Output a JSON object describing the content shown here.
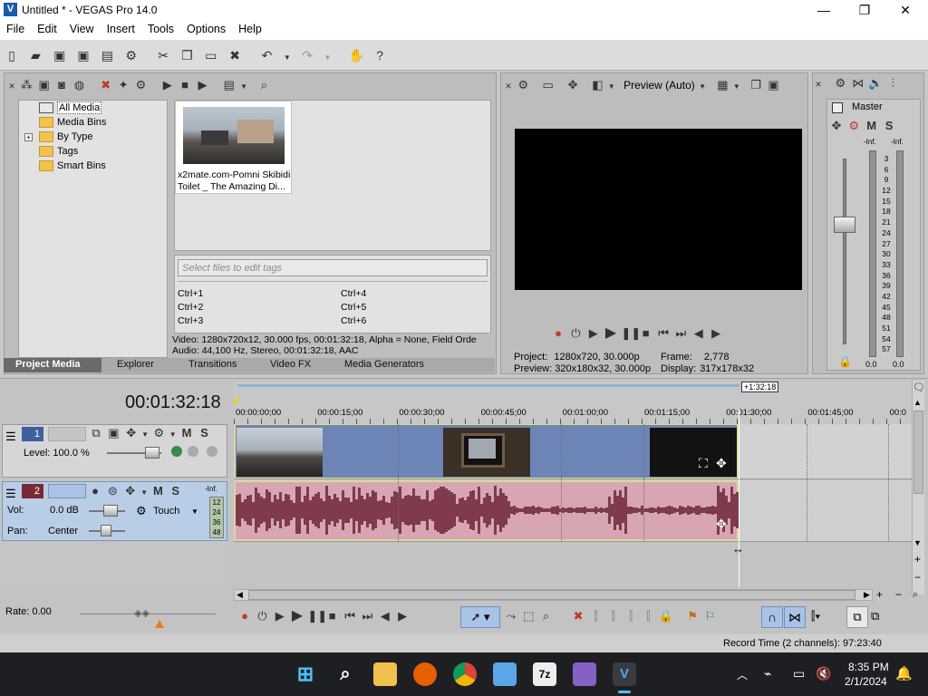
{
  "window": {
    "title": "Untitled * - VEGAS Pro 14.0",
    "minimize": "—",
    "maximize": "❐",
    "close": "✕"
  },
  "menu": [
    "File",
    "Edit",
    "View",
    "Insert",
    "Tools",
    "Options",
    "Help"
  ],
  "project_media": {
    "tree": [
      "All Media",
      "Media Bins",
      "By Type",
      "Tags",
      "Smart Bins"
    ],
    "thumb_caption_1": "x2mate.com-Pomni Skibidi",
    "thumb_caption_2": "Toilet _ The Amazing Di...",
    "tags_placeholder": "Select files to edit tags",
    "shortcuts": [
      "Ctrl+1",
      "Ctrl+2",
      "Ctrl+3",
      "Ctrl+4",
      "Ctrl+5",
      "Ctrl+6"
    ],
    "info_video": "Video: 1280x720x12, 30.000 fps, 00:01:32:18, Alpha = None, Field Orde",
    "info_audio": "Audio: 44,100 Hz, Stereo, 00:01:32:18, AAC"
  },
  "tabs": [
    "Project Media",
    "Explorer",
    "Transitions",
    "Video FX",
    "Media Generators"
  ],
  "preview": {
    "mode": "Preview (Auto)",
    "project_label": "Project:",
    "project_value": "1280x720, 30.000p",
    "preview_label": "Preview:",
    "preview_value": "320x180x32, 30.000p",
    "frame_label": "Frame:",
    "frame_value": "2,778",
    "display_label": "Display:",
    "display_value": "317x178x32"
  },
  "master": {
    "label": "Master",
    "m": "M",
    "s": "S",
    "inf_left": "-Inf.",
    "inf_right": "-Inf.",
    "scale": [
      "3",
      "6",
      "9",
      "12",
      "15",
      "18",
      "21",
      "24",
      "27",
      "30",
      "33",
      "36",
      "39",
      "42",
      "45",
      "48",
      "51",
      "54",
      "57"
    ],
    "bottom_left": "0.0",
    "bottom_right": "0.0"
  },
  "timeline": {
    "timecode": "00:01:32:18",
    "end_marker": "+1:32:18",
    "ruler": [
      "00:00:00;00",
      "00:00:15;00",
      "00:00:30;00",
      "00:00:45;00",
      "00:01:00;00",
      "00:01:15;00",
      "00:01:30;00",
      "00:01:45;00",
      "00:0"
    ],
    "rate": "Rate: 0.00"
  },
  "track1": {
    "number": "1",
    "level": "Level: 100.0 %",
    "m": "M",
    "s": "S"
  },
  "track2": {
    "number": "2",
    "m": "M",
    "s": "S",
    "vol_label": "Vol:",
    "vol_value": "0.0 dB",
    "pan_label": "Pan:",
    "pan_value": "Center",
    "touch": "Touch",
    "meter_inf": "-Inf.",
    "meter_scale": [
      "12",
      "24",
      "36",
      "48"
    ]
  },
  "status": {
    "record_time": "Record Time (2 channels): 97:23:40"
  },
  "clock": {
    "time": "8:35 PM",
    "date": "2/1/2024"
  },
  "colors": {
    "video_clip": "#6d84b6",
    "audio_clip": "#d7a6b2",
    "audio_wave": "#7f3b4b",
    "track_header": "#b9cde6"
  }
}
